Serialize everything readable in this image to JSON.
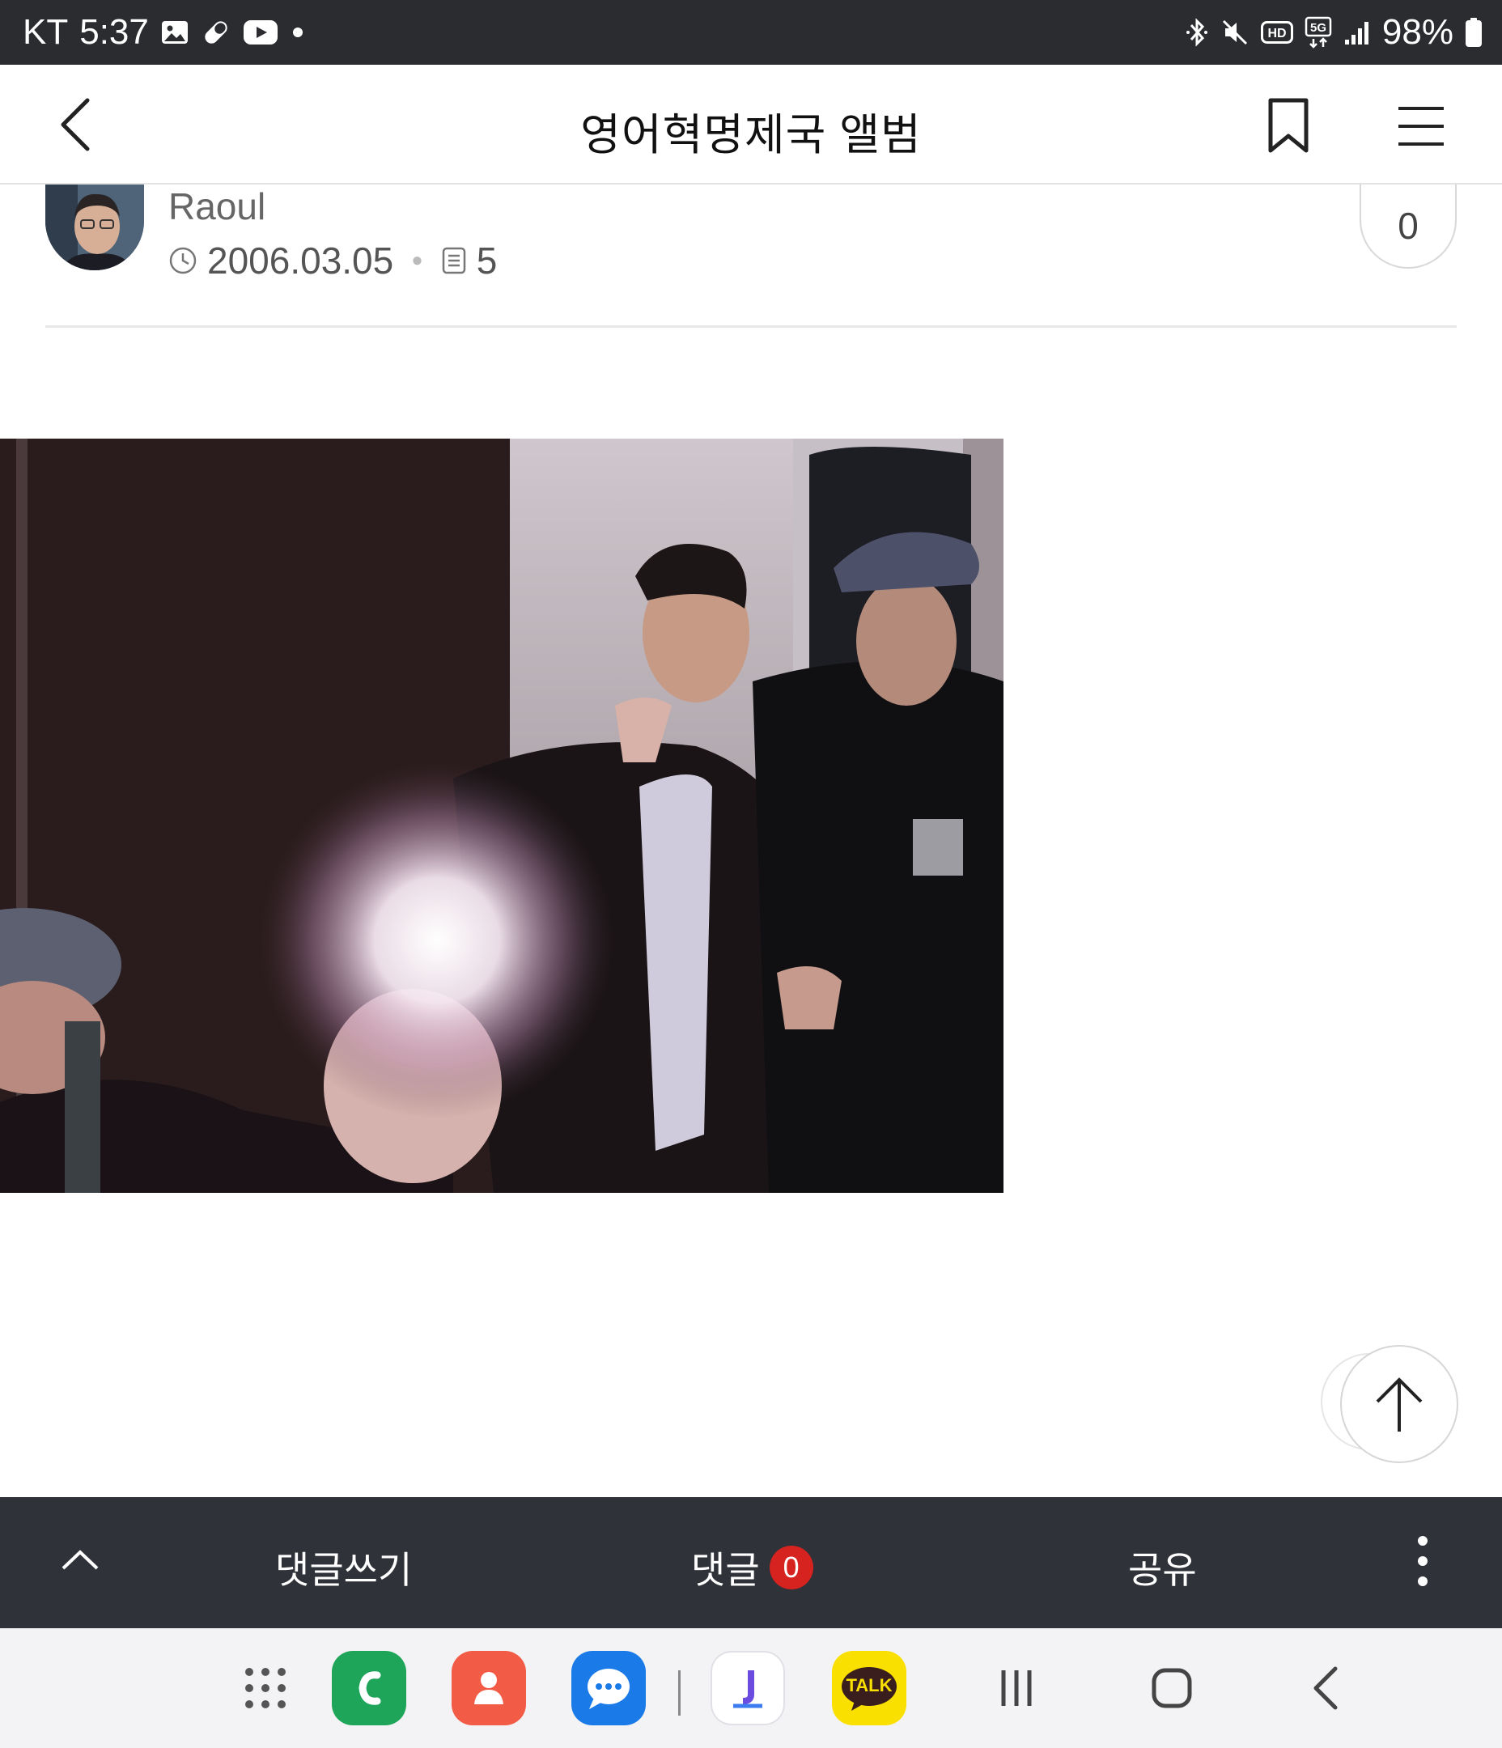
{
  "status_bar": {
    "carrier": "KT",
    "time": "5:37",
    "battery": "98%",
    "network_badge": "5G",
    "hd_badge": "HD"
  },
  "header": {
    "title": "영어혁명제국 앨범"
  },
  "post": {
    "author": "Raoul",
    "date": "2006.03.05",
    "views": "5",
    "like_count": "0"
  },
  "action_bar": {
    "write_comment": "댓글쓰기",
    "comments": "댓글",
    "comment_count": "0",
    "share": "공유"
  },
  "dock": {
    "apps": [
      "apps-grid-icon",
      "phone-icon",
      "contacts-icon",
      "messages-icon",
      "browser-icon",
      "kakaotalk-icon"
    ],
    "kakaotalk_label": "TALK"
  },
  "colors": {
    "status_bar": "#2a2c30",
    "action_bar": "#2f3238",
    "badge": "#d6231f",
    "nav_bar": "#f3f3f6"
  }
}
